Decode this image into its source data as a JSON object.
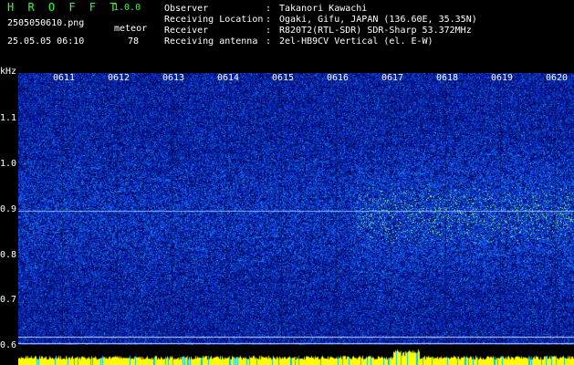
{
  "header": {
    "app_title": "H R O F F T",
    "version": "1.0.0",
    "file_name": "2505050610.png",
    "timestamp": "25.05.05 06:10",
    "observation_label": "meteor",
    "observation_count": "78"
  },
  "info": [
    {
      "key": "Observer",
      "value": "Takanori Kawachi"
    },
    {
      "key": "Receiving Location",
      "value": "Ogaki, Gifu, JAPAN (136.60E, 35.35N)"
    },
    {
      "key": "Receiver",
      "value": "R820T2(RTL-SDR) SDR-Sharp 53.372MHz"
    },
    {
      "key": "Receiving antenna",
      "value": "2el-HB9CV Vertical (el. E-W)"
    }
  ],
  "spectrogram": {
    "y_unit": "kHz",
    "y_ticks": [
      "1.1",
      "1.0",
      "0.9",
      "0.8",
      "0.7",
      "0.6"
    ],
    "x_ticks": [
      "0611",
      "0612",
      "0613",
      "0614",
      "0615",
      "0616",
      "0617",
      "0618",
      "0619",
      "0620"
    ],
    "colors": {
      "background": "#000080",
      "noise": "#1e3cff",
      "signal": "#39ff39",
      "strip": "#ffff00",
      "label": "#ffffff"
    }
  }
}
